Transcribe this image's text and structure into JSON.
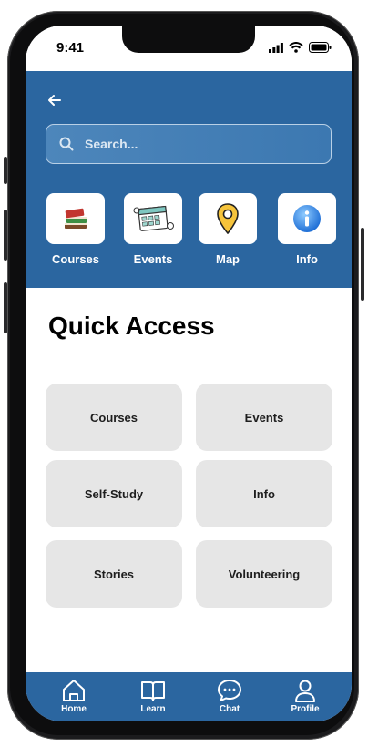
{
  "status_bar": {
    "time": "9:41"
  },
  "search": {
    "placeholder": "Search..."
  },
  "categories": [
    {
      "label": "Courses",
      "icon": "books-icon"
    },
    {
      "label": "Events",
      "icon": "calendar-icon"
    },
    {
      "label": "Map",
      "icon": "map-pin-icon"
    },
    {
      "label": "Info",
      "icon": "info-icon"
    }
  ],
  "quick_access": {
    "title": "Quick Access",
    "items": [
      "Courses",
      "Events",
      "Self-Study",
      "Info",
      "Stories",
      "Volunteering"
    ]
  },
  "bottom_nav": [
    {
      "label": "Home",
      "icon": "home-icon"
    },
    {
      "label": "Learn",
      "icon": "book-icon"
    },
    {
      "label": "Chat",
      "icon": "chat-icon"
    },
    {
      "label": "Profile",
      "icon": "profile-icon"
    }
  ],
  "colors": {
    "primary": "#2b66a0",
    "tile": "#e6e6e6",
    "text": "#000000"
  }
}
